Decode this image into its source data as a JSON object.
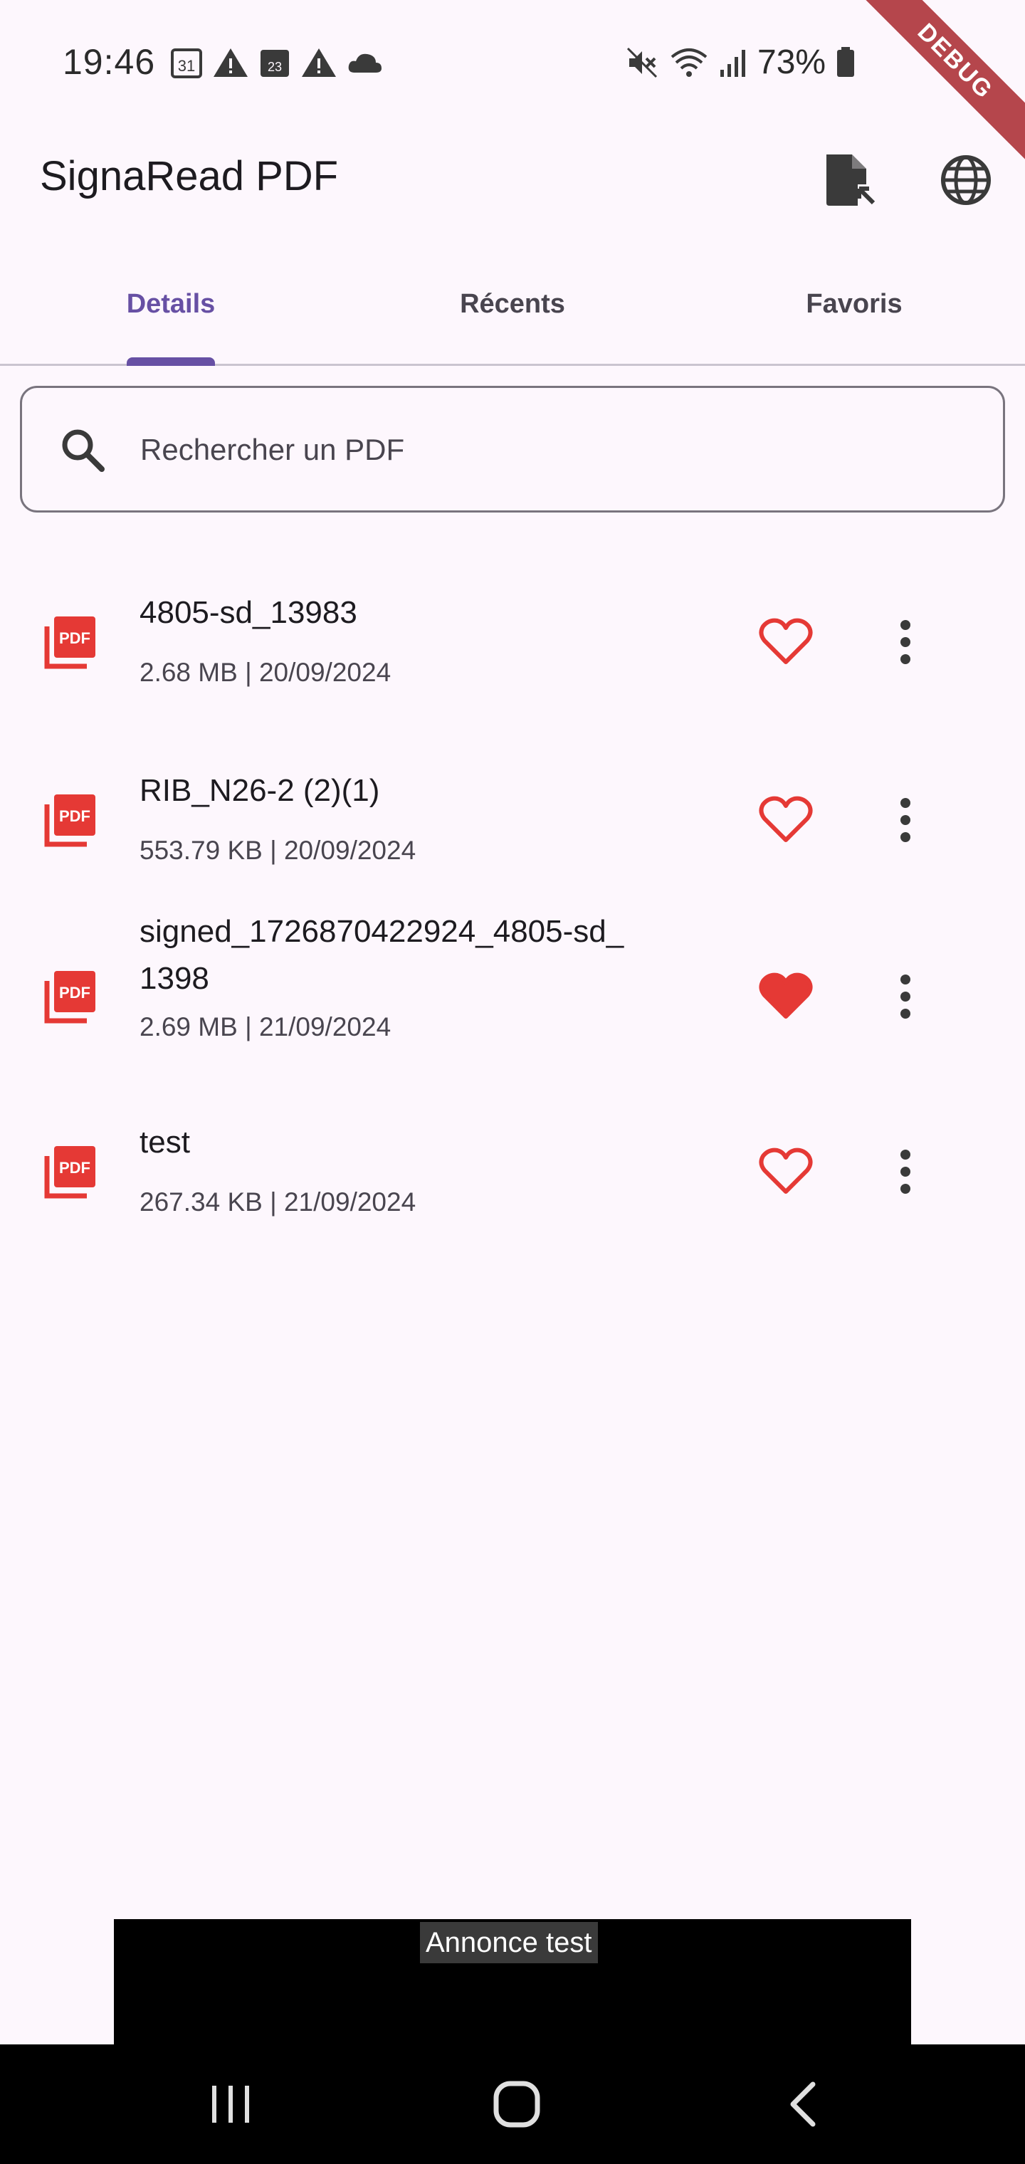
{
  "status_bar": {
    "time": "19:46",
    "battery": "73%",
    "calendar_date": "31",
    "calendar_small_date": "23",
    "debug_label": "DEBUG"
  },
  "app_bar": {
    "title": "SignaRead PDF",
    "actions": [
      "open-file-icon",
      "language-globe-icon"
    ]
  },
  "tabs": [
    {
      "label": "Details",
      "active": true
    },
    {
      "label": "Récents",
      "active": false
    },
    {
      "label": "Favoris",
      "active": false
    }
  ],
  "search": {
    "placeholder": "Rechercher un PDF"
  },
  "files": [
    {
      "name": "4805-sd_13983",
      "meta": "2.68 MB | 20/09/2024",
      "favorite": false
    },
    {
      "name": "RIB_N26-2 (2)(1)",
      "meta": "553.79 KB | 20/09/2024",
      "favorite": false
    },
    {
      "name": "signed_1726870422924_4805-sd_1398",
      "meta": "2.69 MB | 21/09/2024",
      "favorite": true
    },
    {
      "name": "test",
      "meta": "267.34 KB | 21/09/2024",
      "favorite": false
    }
  ],
  "ad": {
    "label": "Annonce test"
  },
  "colors": {
    "accent": "#6750a4",
    "pdf_red": "#e53935",
    "heart_red": "#e53935",
    "background": "#fdf7fd"
  }
}
